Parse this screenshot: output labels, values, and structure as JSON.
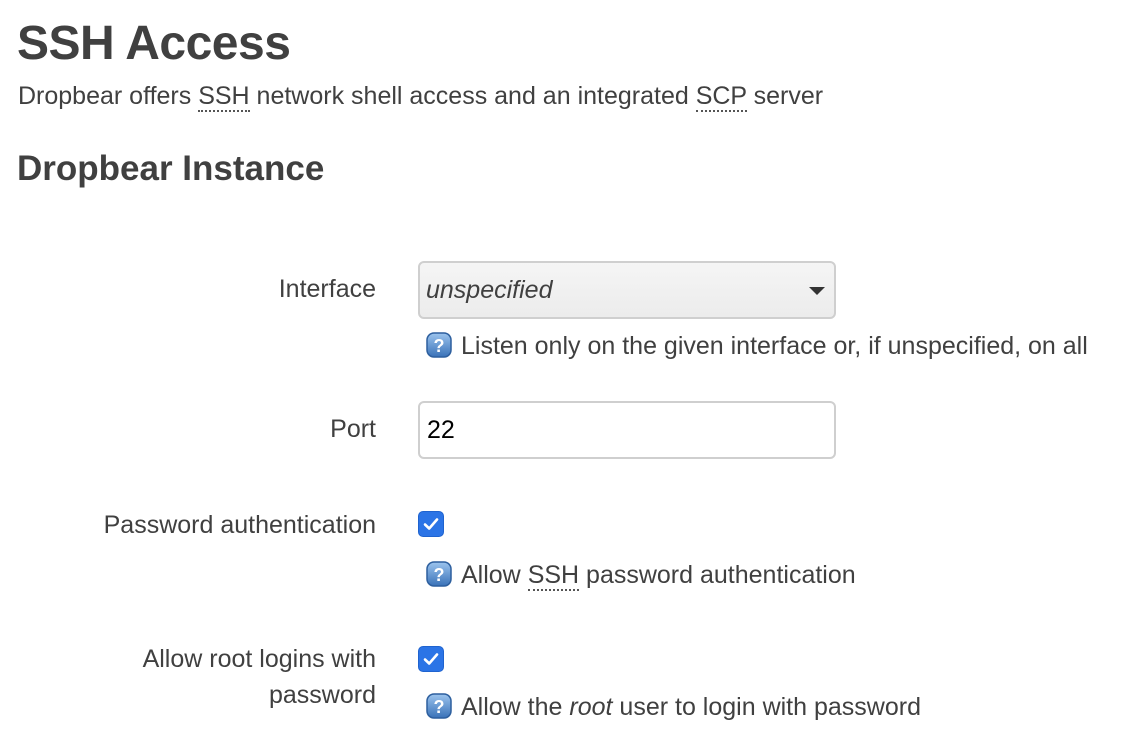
{
  "page": {
    "title": "SSH Access",
    "description_before": "Dropbear offers ",
    "description_abbr1": "SSH",
    "description_middle": " network shell access and an integrated ",
    "description_abbr2": "SCP",
    "description_after": " server"
  },
  "section": {
    "title": "Dropbear Instance"
  },
  "fields": {
    "interface": {
      "label": "Interface",
      "value": "unspecified",
      "help_icon": "help-question-icon",
      "help": "Listen only on the given interface or, if unspecified, on all"
    },
    "port": {
      "label": "Port",
      "value": "22"
    },
    "password_auth": {
      "label": "Password authentication",
      "checked": true,
      "help_before": "Allow ",
      "help_abbr": "SSH",
      "help_after": " password authentication"
    },
    "root_login": {
      "label": "Allow root logins with password",
      "checked": true,
      "help_before": "Allow the ",
      "help_em": "root",
      "help_after": " user to login with password"
    }
  },
  "colors": {
    "text": "#404040",
    "checkbox_accent": "#2b74e6",
    "help_icon": "#3e7cc4"
  }
}
